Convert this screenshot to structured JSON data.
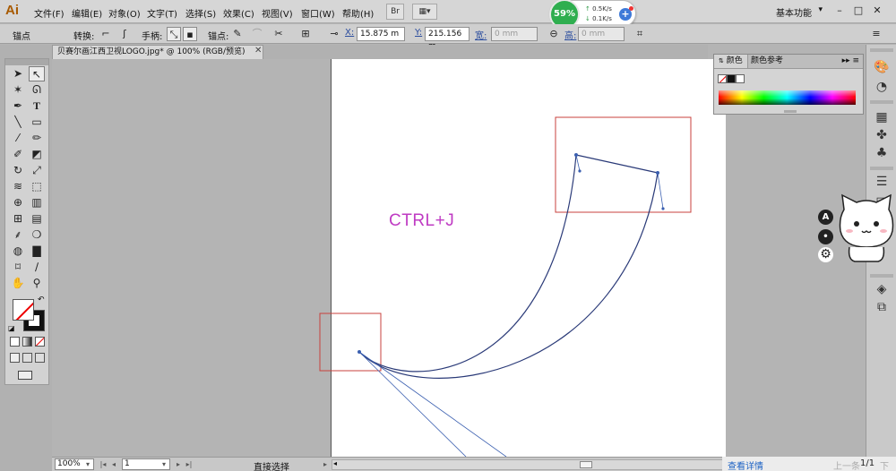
{
  "app": {
    "logo": "Ai"
  },
  "menu": {
    "items": [
      "文件(F)",
      "编辑(E)",
      "对象(O)",
      "文字(T)",
      "选择(S)",
      "效果(C)",
      "视图(V)",
      "窗口(W)",
      "帮助(H)"
    ],
    "bridge_label": "Br",
    "workspace": "基本功能"
  },
  "speed": {
    "percent": "59%",
    "up": "0.5K/s",
    "down": "0.1K/s"
  },
  "control": {
    "anchor_label": "锚点",
    "convert_label": "转换:",
    "handle_label": "手柄:",
    "anchors_label": "锚点:",
    "x_label": "X:",
    "x_value": "15.875 m",
    "y_label": "Y:",
    "y_value": "215.156 m",
    "w_label": "宽:",
    "w_value": "0 mm",
    "h_label": "高:",
    "h_value": "0 mm"
  },
  "document": {
    "tab_title": "贝赛尔画江西卫视LOGO.jpg* @ 100% (RGB/预览)"
  },
  "canvas": {
    "annotation": "CTRL+J"
  },
  "status": {
    "zoom": "100%",
    "page": "1",
    "current_tool": "直接选择"
  },
  "color_panel": {
    "tab_color": "颜色",
    "tab_guide": "颜色参考",
    "menu": "▸▸ ≡"
  },
  "overlay": {
    "detail_link": "查看详情",
    "prev": "上一条",
    "count": "1/1",
    "next": "下一"
  },
  "colors": {
    "annotation_text": "#bf3bc3",
    "path_stroke": "#2a3a78",
    "selection_box": "#c8413c",
    "anchor": "#3a5fb0"
  },
  "icons": [
    "selection-arrow-icon",
    "direct-selection-icon",
    "magic-wand-icon",
    "lasso-icon",
    "pen-icon",
    "type-icon",
    "line-icon",
    "rectangle-icon",
    "brush-icon",
    "pencil-icon",
    "blob-brush-icon",
    "eraser-icon",
    "rotate-icon",
    "scale-icon",
    "warp-icon",
    "free-transform-icon",
    "shape-builder-icon",
    "perspective-icon",
    "mesh-icon",
    "gradient-icon",
    "eyedropper-icon",
    "blend-icon",
    "symbol-sprayer-icon",
    "column-graph-icon",
    "artboard-icon",
    "slice-icon",
    "hand-icon",
    "zoom-icon"
  ]
}
